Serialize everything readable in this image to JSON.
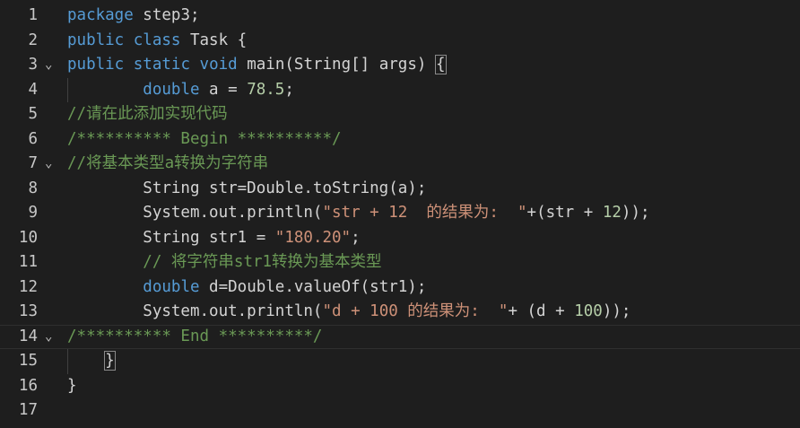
{
  "editor": {
    "lines": [
      {
        "num": "1",
        "tokens": [
          [
            "kw",
            "package"
          ],
          [
            "id",
            " step3;"
          ]
        ]
      },
      {
        "num": "2",
        "tokens": [
          [
            "kw",
            "public"
          ],
          [
            "id",
            " "
          ],
          [
            "kw",
            "class"
          ],
          [
            "id",
            " Task {"
          ]
        ]
      },
      {
        "num": "3",
        "fold": "⌄",
        "tokens": [
          [
            "kw",
            "public"
          ],
          [
            "id",
            " "
          ],
          [
            "kw",
            "static"
          ],
          [
            "id",
            " "
          ],
          [
            "kw",
            "void"
          ],
          [
            "id",
            " main(String[] args) "
          ],
          [
            "br",
            "{"
          ]
        ]
      },
      {
        "num": "4",
        "guide": true,
        "tokens": [
          [
            "id",
            "        "
          ],
          [
            "kw",
            "double"
          ],
          [
            "id",
            " a = "
          ],
          [
            "num",
            "78.5"
          ],
          [
            "id",
            ";"
          ]
        ]
      },
      {
        "num": "5",
        "tokens": [
          [
            "cm",
            "//请在此添加实现代码"
          ]
        ]
      },
      {
        "num": "6",
        "tokens": [
          [
            "cm",
            "/********** Begin **********/"
          ]
        ]
      },
      {
        "num": "7",
        "fold": "⌄",
        "tokens": [
          [
            "cm",
            "//将基本类型a转换为字符串"
          ]
        ]
      },
      {
        "num": "8",
        "tokens": [
          [
            "id",
            "        String str=Double.toString(a);"
          ]
        ]
      },
      {
        "num": "9",
        "tokens": [
          [
            "id",
            "        System.out.println("
          ],
          [
            "str",
            "\"str + 12  的结果为:  \""
          ],
          [
            "id",
            "+(str + "
          ],
          [
            "num",
            "12"
          ],
          [
            "id",
            "));"
          ]
        ]
      },
      {
        "num": "10",
        "tokens": [
          [
            "id",
            "        String str1 = "
          ],
          [
            "str",
            "\"180.20\""
          ],
          [
            "id",
            ";"
          ]
        ]
      },
      {
        "num": "11",
        "tokens": [
          [
            "id",
            "        "
          ],
          [
            "cm",
            "// 将字符串str1转换为基本类型"
          ]
        ]
      },
      {
        "num": "12",
        "tokens": [
          [
            "id",
            "        "
          ],
          [
            "kw",
            "double"
          ],
          [
            "id",
            " d=Double.valueOf(str1);"
          ]
        ]
      },
      {
        "num": "13",
        "tokens": [
          [
            "id",
            "        System.out.println("
          ],
          [
            "str",
            "\"d + 100 的结果为:  \""
          ],
          [
            "id",
            "+ (d + "
          ],
          [
            "num",
            "100"
          ],
          [
            "id",
            "));"
          ]
        ]
      },
      {
        "num": "14",
        "fold": "⌄",
        "current": true,
        "tokens": [
          [
            "cm",
            "/********** End **********/"
          ]
        ]
      },
      {
        "num": "15",
        "guide": true,
        "tokens": [
          [
            "id",
            "    "
          ],
          [
            "br",
            "}"
          ]
        ]
      },
      {
        "num": "16",
        "tokens": [
          [
            "id",
            "}"
          ]
        ]
      },
      {
        "num": "17",
        "tokens": []
      }
    ]
  }
}
